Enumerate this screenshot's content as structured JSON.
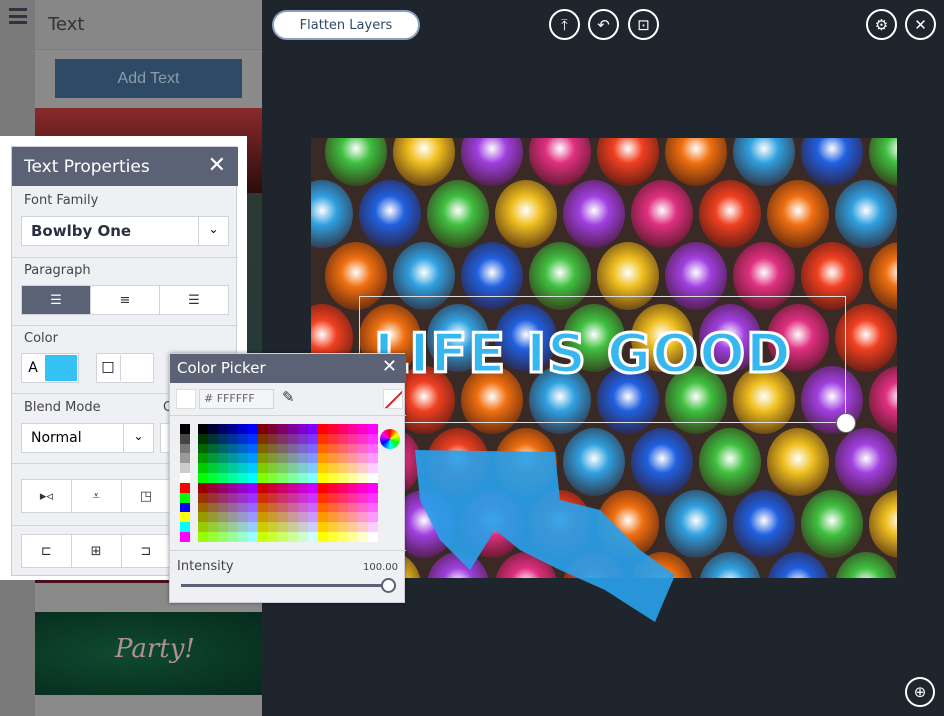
{
  "sidebar": {
    "title": "Text",
    "add_text_label": "Add Text",
    "thumbnail_text": "Party!"
  },
  "toolbar": {
    "flatten_label": "Flatten Layers",
    "icons": [
      "upload-icon",
      "undo-icon",
      "save-icon",
      "gear-icon",
      "close-icon",
      "zoom-icon"
    ]
  },
  "text_properties": {
    "title": "Text Properties",
    "font_family_label": "Font Family",
    "font_family_value": "Bowlby One",
    "paragraph_label": "Paragraph",
    "color_label": "Color",
    "text_color": "#35c3f5",
    "stroke_color": "#ffffff",
    "text_color_letter": "A",
    "blend_mode_label": "Blend Mode",
    "blend_mode_value": "Normal",
    "opacity_label_partial": "C"
  },
  "color_picker": {
    "title": "Color Picker",
    "hex_value": "# FFFFFF",
    "intensity_label": "Intensity",
    "intensity_value": "100.00",
    "intensity": 100
  },
  "canvas": {
    "text": "LIFE IS GOOD",
    "text_color": "#35b8f0"
  }
}
